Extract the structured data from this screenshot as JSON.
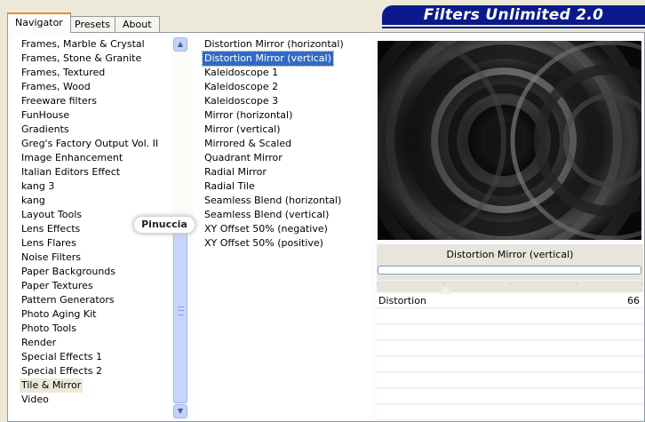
{
  "tabs": [
    {
      "label": "Navigator"
    },
    {
      "label": "Presets"
    },
    {
      "label": "About"
    }
  ],
  "banner": {
    "title": "Filters Unlimited 2.0"
  },
  "categories": {
    "items": [
      "Frames, Marble & Crystal",
      "Frames, Stone & Granite",
      "Frames, Textured",
      "Frames, Wood",
      "Freeware filters",
      "FunHouse",
      "Gradients",
      "Greg's Factory Output Vol. II",
      "Image Enhancement",
      "Italian Editors Effect",
      "kang 3",
      "kang",
      "Layout Tools",
      "Lens Effects",
      "Lens Flares",
      "Noise Filters",
      "Paper Backgrounds",
      "Paper Textures",
      "Pattern Generators",
      "Photo Aging Kit",
      "Photo Tools",
      "Render",
      "Special Effects 1",
      "Special Effects 2",
      "Tile & Mirror",
      "Video"
    ],
    "selected": "Tile & Mirror"
  },
  "filters": {
    "items": [
      "Distortion Mirror (horizontal)",
      "Distortion Mirror (vertical)",
      "Kaleidoscope 1",
      "Kaleidoscope 2",
      "Kaleidoscope 3",
      "Mirror (horizontal)",
      "Mirror (vertical)",
      "Mirrored & Scaled",
      "Quadrant Mirror",
      "Radial Mirror",
      "Radial Tile",
      "Seamless Blend (horizontal)",
      "Seamless Blend (vertical)",
      "XY Offset 50% (negative)",
      "XY Offset 50% (positive)"
    ],
    "selected": "Distortion Mirror (vertical)"
  },
  "watermark": {
    "text": "Pinuccia"
  },
  "filter_name": "Distortion Mirror (vertical)",
  "params": [
    {
      "label": "Distortion",
      "value": "66"
    }
  ],
  "colors": {
    "banner": "#0a1a8c",
    "selection": "#316ac5",
    "tab_accent": "#e68b2c"
  },
  "icons": {
    "scroll_up": "chevron-up-icon",
    "scroll_down": "chevron-down-icon"
  }
}
